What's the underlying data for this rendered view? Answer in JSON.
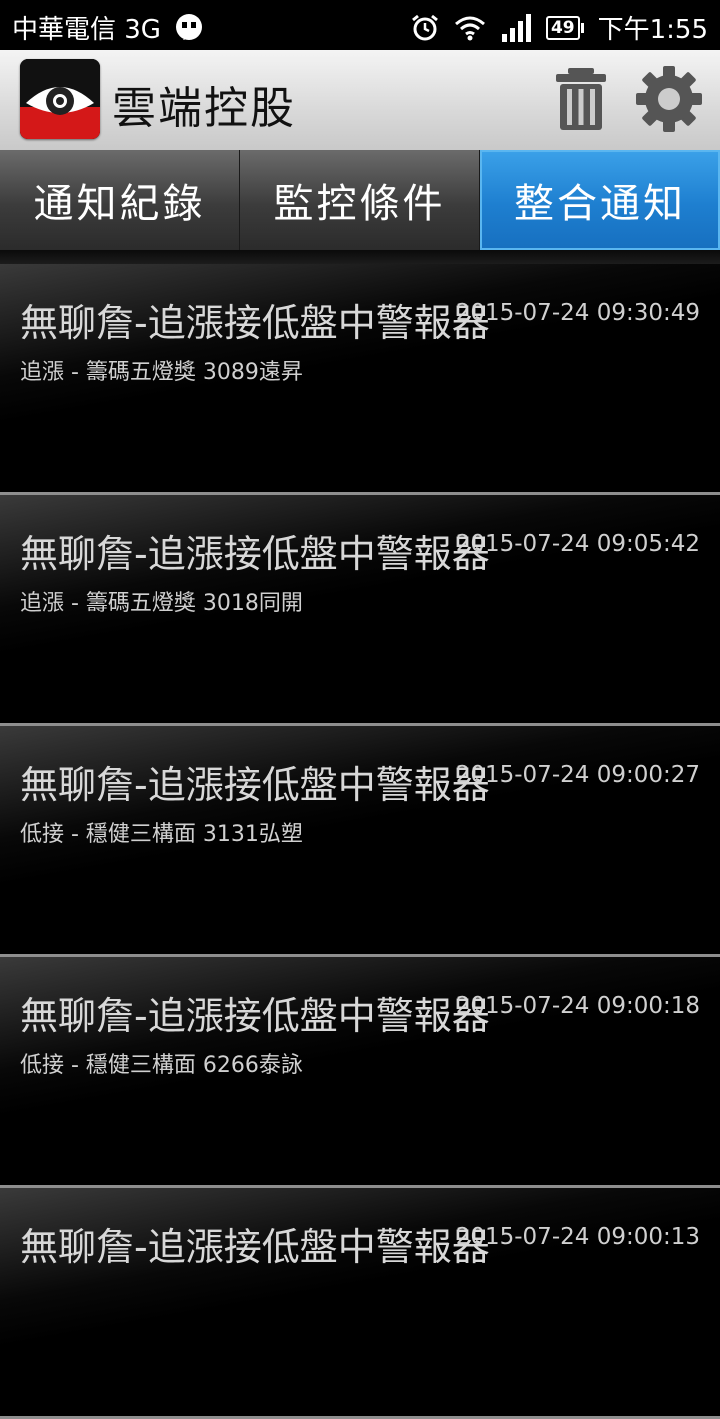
{
  "status_bar": {
    "carrier": "中華電信 3G",
    "battery": "49",
    "time": "下午1:55"
  },
  "header": {
    "title": "雲端控股",
    "icons": [
      "eye-logo-icon",
      "trash-icon",
      "gear-icon"
    ]
  },
  "tabs": [
    {
      "label": "通知紀錄",
      "active": false
    },
    {
      "label": "監控條件",
      "active": false
    },
    {
      "label": "整合通知",
      "active": true
    }
  ],
  "notifications": [
    {
      "title": "無聊詹-追漲接低盤中警報器",
      "time": "2015-07-24 09:30:49",
      "detail": "追漲 - 籌碼五燈獎 3089遠昇"
    },
    {
      "title": "無聊詹-追漲接低盤中警報器",
      "time": "2015-07-24 09:05:42",
      "detail": "追漲 - 籌碼五燈獎 3018同開"
    },
    {
      "title": "無聊詹-追漲接低盤中警報器",
      "time": "2015-07-24 09:00:27",
      "detail": "低接 - 穩健三構面 3131弘塑"
    },
    {
      "title": "無聊詹-追漲接低盤中警報器",
      "time": "2015-07-24 09:00:18",
      "detail": "低接 - 穩健三構面 6266泰詠"
    },
    {
      "title": "無聊詹-追漲接低盤中警報器",
      "time": "2015-07-24 09:00:13",
      "detail": ""
    }
  ],
  "colors": {
    "active_tab": "#1e7fd0",
    "inactive_tab": "#3c3c3c",
    "header_bg": "#d9d9d9",
    "logo_red": "#d41818"
  }
}
